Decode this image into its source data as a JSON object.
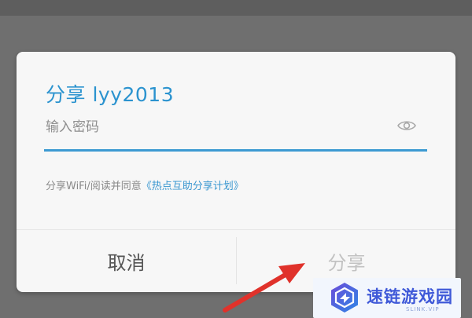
{
  "dialog": {
    "title": "分享 lyy2013",
    "password_placeholder": "输入密码",
    "password_value": "",
    "agreement_prefix": "分享WiFi/阅读并同意",
    "agreement_link": "《热点互助分享计划》",
    "cancel_label": "取消",
    "share_label": "分享",
    "eye_icon": "eye-icon"
  },
  "watermark": {
    "text": "速链游戏园",
    "sub": "SLINK.VIP"
  },
  "colors": {
    "accent": "#3c9ad2",
    "title": "#2b93cf",
    "disabled_button": "#c2c2c2",
    "arrow": "#e0322b",
    "watermark_text": "#3f59d8"
  }
}
